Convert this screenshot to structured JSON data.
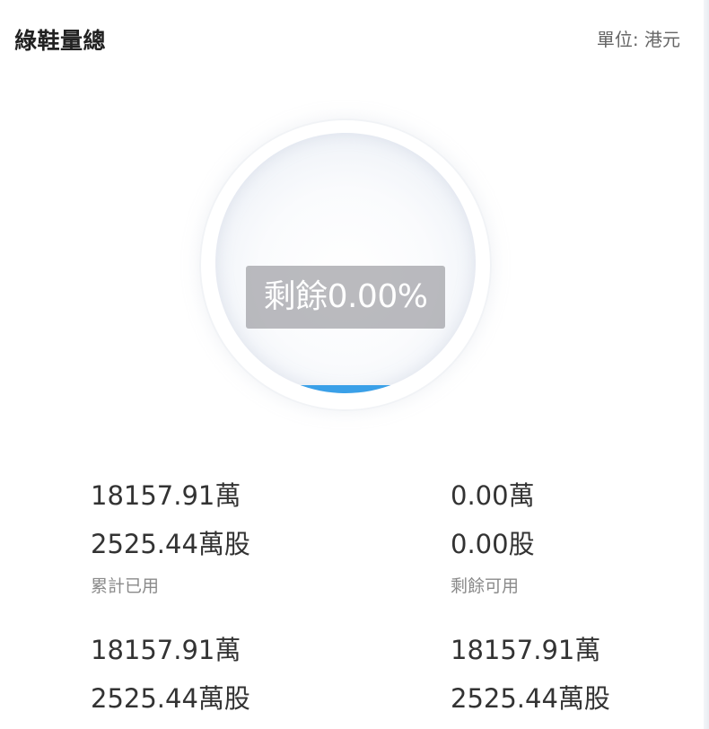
{
  "header": {
    "title": "綠鞋量總",
    "unit": "單位: 港元"
  },
  "gauge": {
    "label": "剩餘0.00%",
    "remaining_percent": 0.0,
    "fill_color": "#3aa0e8"
  },
  "stats": [
    {
      "amount": "18157.91萬",
      "shares": "2525.44萬股",
      "caption": "累計已用"
    },
    {
      "amount": "0.00萬",
      "shares": "0.00股",
      "caption": "剩餘可用"
    },
    {
      "amount": "18157.91萬",
      "shares": "2525.44萬股",
      "caption": ""
    },
    {
      "amount": "18157.91萬",
      "shares": "2525.44萬股",
      "caption": ""
    }
  ]
}
